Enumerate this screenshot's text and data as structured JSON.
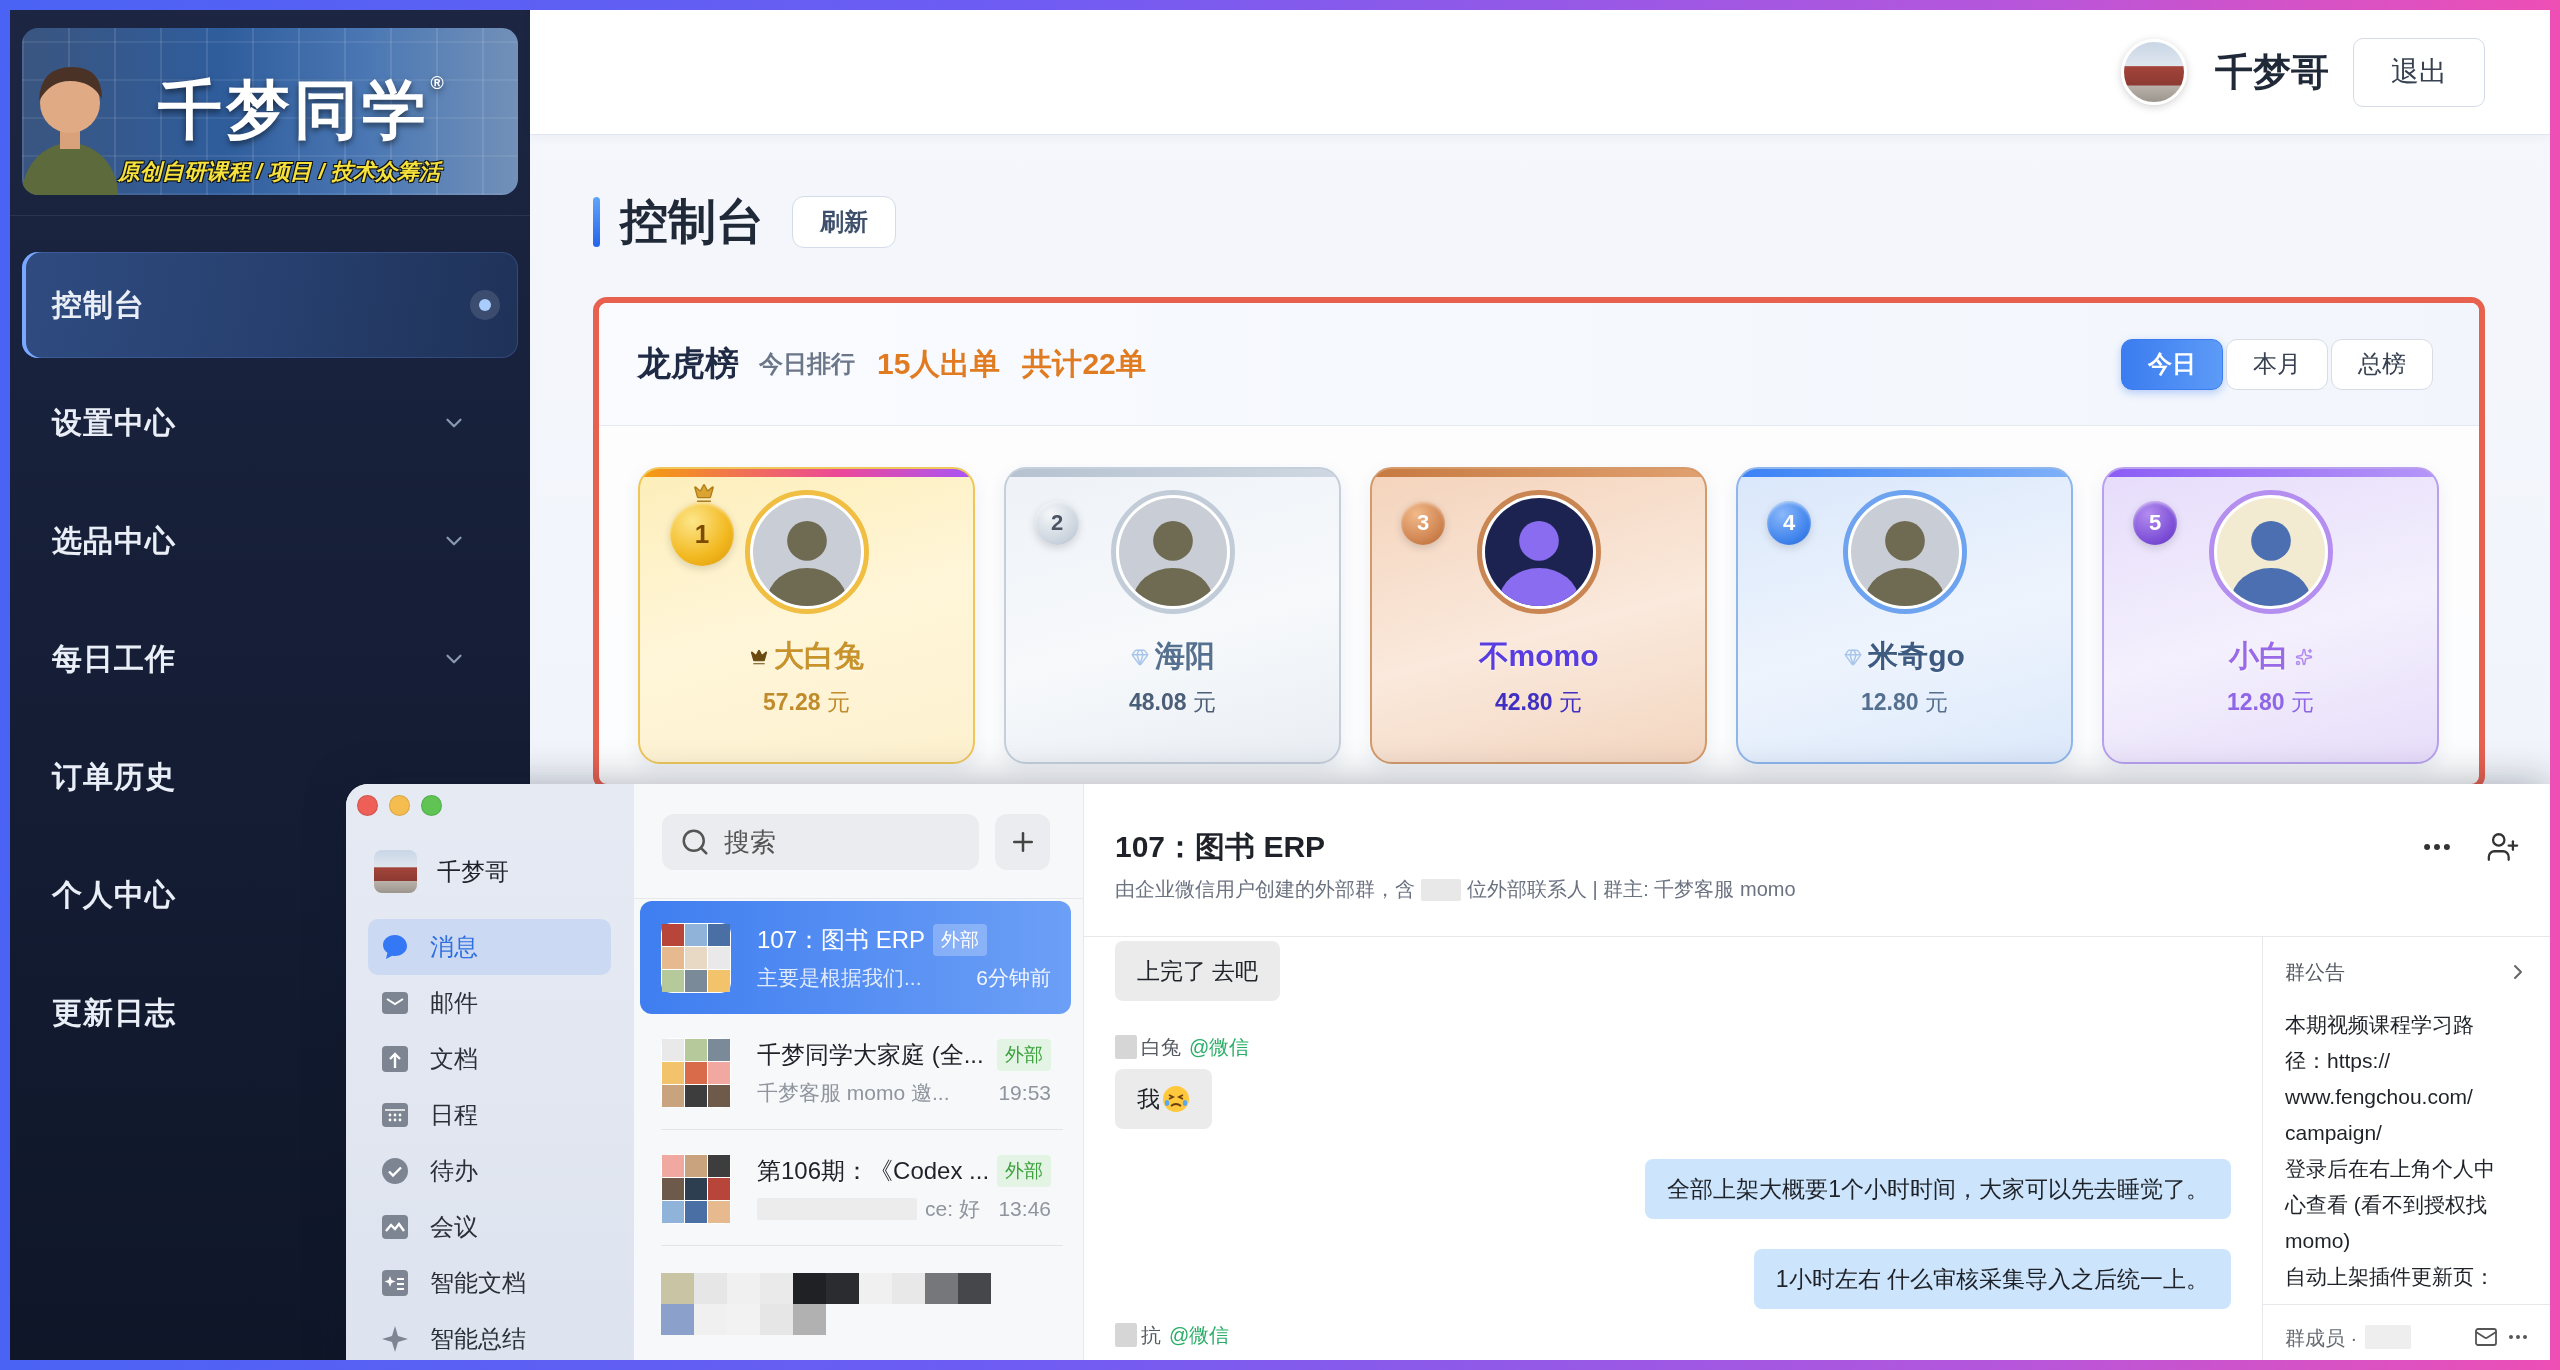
{
  "sidebar": {
    "logo": {
      "title": "千梦同学$^{®}$",
      "tagline": "原创自研课程 / 项目 / 技术众筹活"
    },
    "items": [
      {
        "label": "控制台",
        "kind": "link",
        "selected": true
      },
      {
        "label": "设置中心",
        "kind": "group",
        "selected": false
      },
      {
        "label": "选品中心",
        "kind": "group",
        "selected": false
      },
      {
        "label": "每日工作",
        "kind": "group",
        "selected": false
      },
      {
        "label": "订单历史",
        "kind": "link",
        "selected": false
      },
      {
        "label": "个人中心",
        "kind": "link",
        "selected": false
      },
      {
        "label": "更新日志",
        "kind": "link",
        "selected": false
      }
    ]
  },
  "header": {
    "user_name": "千梦哥",
    "logout_button": "退出"
  },
  "page": {
    "title": "控制台",
    "refresh_button": "刷新"
  },
  "leaderboard": {
    "title": "龙虎榜",
    "subtitle": "今日排行",
    "stats": [
      "15人出单",
      "共计22单"
    ],
    "tabs": [
      {
        "label": "今日",
        "selected": true
      },
      {
        "label": "本月",
        "selected": false
      },
      {
        "label": "总榜",
        "selected": false
      }
    ],
    "entries": [
      {
        "rank": "1",
        "kind": "gold",
        "name": "大白兔",
        "amount": "**57.28** 元"
      },
      {
        "rank": "2",
        "kind": "silver",
        "name": "海阳",
        "amount": "**48.08** 元"
      },
      {
        "rank": "3",
        "kind": "bronze",
        "name": "不momo",
        "amount": "**42.80** 元"
      },
      {
        "rank": "4",
        "kind": "blue",
        "name": "米奇go",
        "amount": "**12.80** 元"
      },
      {
        "rank": "5",
        "kind": "purple",
        "name": "小白",
        "amount": "**12.80** 元"
      }
    ]
  },
  "chat_window": {
    "nav": {
      "user_name": "千梦哥",
      "items": [
        {
          "label": "消息",
          "kind": "messages",
          "selected": true
        },
        {
          "label": "邮件",
          "kind": "mail",
          "selected": false
        },
        {
          "label": "文档",
          "kind": "docs",
          "selected": false
        },
        {
          "label": "日程",
          "kind": "calendar",
          "selected": false
        },
        {
          "label": "待办",
          "kind": "todo",
          "selected": false
        },
        {
          "label": "会议",
          "kind": "meeting",
          "selected": false
        },
        {
          "label": "智能文档",
          "kind": "smartdoc",
          "selected": false
        },
        {
          "label": "智能总结",
          "kind": "summary",
          "selected": false
        }
      ]
    },
    "search": {
      "placeholder": "搜索"
    },
    "conversations": [
      {
        "title": "107：图书 ERP",
        "tag": "外部",
        "preview": "主要是根据我们...",
        "time": "6分钟前",
        "redacted_prefix": false,
        "selected": true
      },
      {
        "title": "千梦同学大家庭 (全...",
        "tag": "外部",
        "preview": "千梦客服 momo 邀...",
        "time": "19:53",
        "redacted_prefix": false,
        "selected": false
      },
      {
        "title": "第106期：《Codex ...",
        "tag": "外部",
        "preview": "ce: 好",
        "time": "13:46",
        "redacted_prefix": true,
        "selected": false
      }
    ],
    "conversation": {
      "title": "107：图书 ERP",
      "subtitle_start": "由企业微信用户创建的外部群，含",
      "subtitle_end": "位外部联系人 | 群主: 千梦客服 momo",
      "messages": [
        {
          "kind": "incoming",
          "text": "上完了 去吧",
          "emoji": false
        },
        {
          "kind": "sender",
          "name": "白兔",
          "source": "@微信"
        },
        {
          "kind": "incoming",
          "text": "我",
          "emoji": true
        },
        {
          "kind": "outgoing",
          "text": "全部上架大概要1个小时时间，大家可以先去睡觉了。",
          "emoji": false
        },
        {
          "kind": "outgoing",
          "text": "1小时左右 什么审核采集导入之后统一上。",
          "emoji": false
        },
        {
          "kind": "sender",
          "name": "抗",
          "source": "@微信"
        }
      ]
    },
    "notice": {
      "title": "群公告",
      "paragraphs": [
        "本期视频课程学习路径：https://www.fengchou.com/campaign/",
        "登录后在右上角个人中心查看 (看不到授权找 momo)",
        "自动上架插件更新页："
      ]
    },
    "members_label": "群成员 ·"
  }
}
